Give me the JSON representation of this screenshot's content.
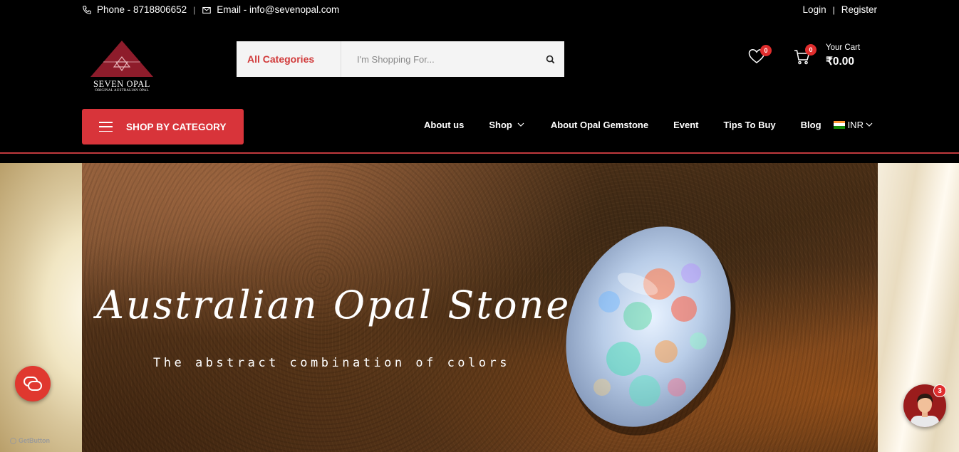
{
  "topbar": {
    "phone": "Phone - 8718806652",
    "email": "Email - info@sevenopal.com",
    "login": "Login",
    "separator": "|",
    "register": "Register"
  },
  "logo": {
    "brand": "SEVEN OPAL",
    "tagline": "ORIGINAL AUSTRALIAN OPAL",
    "color": "#8e1c2b"
  },
  "search": {
    "category": "All Categories",
    "placeholder": "I'm Shopping For..."
  },
  "wishlist": {
    "count": "0"
  },
  "cart": {
    "count": "0",
    "label": "Your Cart",
    "total": "₹0.00"
  },
  "shop_by_category": {
    "label": "SHOP BY CATEGORY"
  },
  "nav": {
    "items": [
      "About us",
      "Shop",
      "About Opal Gemstone",
      "Event",
      "Tips To Buy",
      "Blog"
    ],
    "currency": "INR"
  },
  "hero": {
    "title": "Australian Opal Stone",
    "subtitle": "The abstract combination of colors"
  },
  "widgets": {
    "getbutton": "GetButton",
    "avatar_badge": "3"
  },
  "colors": {
    "accent": "#d8343a",
    "background": "#000000",
    "badge": "#e02d2d"
  }
}
